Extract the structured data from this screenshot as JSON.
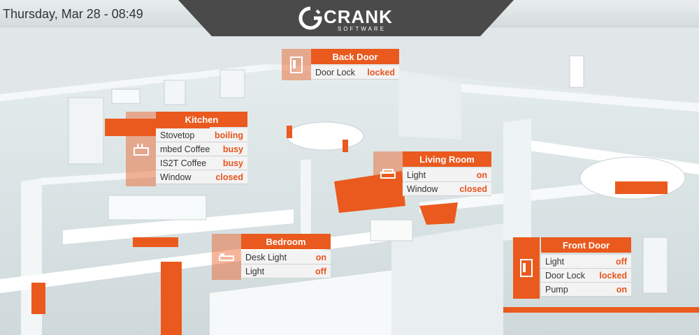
{
  "header": {
    "datetime": "Thursday, Mar 28 - 08:49",
    "logo_text": "CRANK",
    "logo_subtext": "SOFTWARE"
  },
  "colors": {
    "accent": "#ea5a1e",
    "panel": "#4a4a4a"
  },
  "rooms": {
    "back_door": {
      "title": "Back Door",
      "icon": "door-icon",
      "rows": [
        {
          "label": "Door Lock",
          "value": "locked"
        }
      ]
    },
    "kitchen": {
      "title": "Kitchen",
      "icon": "stove-icon",
      "rows": [
        {
          "label": "Stovetop",
          "value": "boiling"
        },
        {
          "label": "mbed Coffee",
          "value": "busy"
        },
        {
          "label": "IS2T Coffee",
          "value": "busy"
        },
        {
          "label": "Window",
          "value": "closed"
        }
      ]
    },
    "living_room": {
      "title": "Living Room",
      "icon": "sofa-icon",
      "rows": [
        {
          "label": "Light",
          "value": "on"
        },
        {
          "label": "Window",
          "value": "closed"
        }
      ]
    },
    "bedroom": {
      "title": "Bedroom",
      "icon": "bed-icon",
      "rows": [
        {
          "label": "Desk Light",
          "value": "on"
        },
        {
          "label": "Light",
          "value": "off"
        }
      ]
    },
    "front_door": {
      "title": "Front Door",
      "icon": "door-icon",
      "rows": [
        {
          "label": "Light",
          "value": "off"
        },
        {
          "label": "Door Lock",
          "value": "locked"
        },
        {
          "label": "Pump",
          "value": "on"
        }
      ]
    }
  }
}
